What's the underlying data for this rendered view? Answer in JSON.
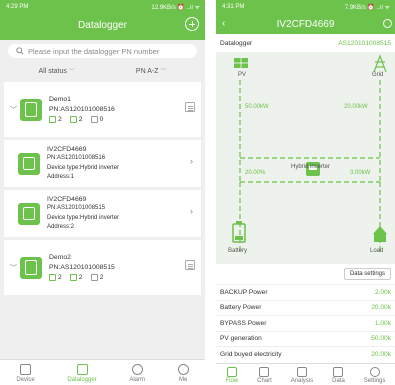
{
  "left": {
    "status": {
      "time": "4:29 PM",
      "right": "12.9KB/s ⏰ ..ıl ᯤ"
    },
    "header": {
      "title": "Datalogger"
    },
    "search": {
      "placeholder": "Please input the datalogger PN number"
    },
    "filters": {
      "status": "All status",
      "sort": "PN A-Z"
    },
    "plants": [
      {
        "name": "Demo1",
        "pn": "PN:AS120101008516",
        "c1": "2",
        "c2": "2",
        "c3": "0"
      },
      {
        "name": "Demo2",
        "pn": "PN:AS120101008515",
        "c1": "2",
        "c2": "2",
        "c3": "2"
      }
    ],
    "devices": [
      {
        "name": "IV2CFD4669",
        "pn": "PN:AS120101008516",
        "type": "Device type:Hybrid inverter",
        "address": "Address:1"
      },
      {
        "name": "IV2CFD4669",
        "pn": "PN:AS120101008515",
        "type": "Device type:Hybrid inverter",
        "address": "Address:2"
      }
    ],
    "tabs": [
      {
        "label": "Device"
      },
      {
        "label": "Datalogger"
      },
      {
        "label": "Alarm"
      },
      {
        "label": "Me"
      }
    ]
  },
  "right": {
    "status": {
      "time": "4:31 PM",
      "right": "7.9KB/s ⏰ ..ıl ᯤ"
    },
    "header": {
      "title": "IV2CFD4669"
    },
    "datalogger": {
      "label": "Datalogger",
      "pn": "AS120101008515"
    },
    "flow": {
      "pv_label": "PV",
      "grid_label": "Grid",
      "pv_power": "50.00kW",
      "grid_power": "20.00kW",
      "inverter_label": "Hybrid inverter",
      "battery_pct": "20.00%",
      "load_power": "3.00kW",
      "battery_label": "Battery",
      "load_label": "Load"
    },
    "data_settings": "Data settings",
    "params": [
      {
        "label": "BACKUP Power",
        "value": "2.00k"
      },
      {
        "label": "Battery Power",
        "value": "20.00k"
      },
      {
        "label": "BYPASS Power",
        "value": "1.00k"
      },
      {
        "label": "PV generation",
        "value": "50.00k"
      },
      {
        "label": "Grid buyed electricity",
        "value": "20.00k"
      }
    ],
    "tabs": [
      {
        "label": "Flow"
      },
      {
        "label": "Chart"
      },
      {
        "label": "Analysis"
      },
      {
        "label": "Data"
      },
      {
        "label": "Settings"
      }
    ]
  },
  "colors": {
    "accent": "#6cc24a"
  }
}
